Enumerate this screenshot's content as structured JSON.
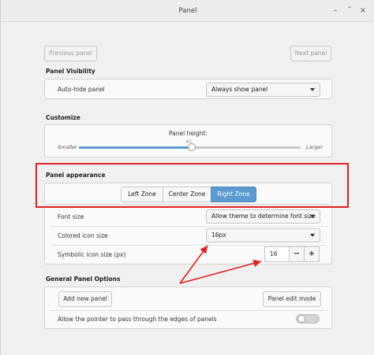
{
  "window": {
    "title": "Panel"
  },
  "nav": {
    "previous_label": "Previous panel",
    "next_label": "Next panel"
  },
  "visibility": {
    "section_title": "Panel Visibility",
    "autohide_label": "Auto-hide panel",
    "autohide_value": "Always show panel"
  },
  "customize": {
    "section_title": "Customize",
    "height_label": "Panel height:",
    "height_value": "40",
    "smaller_label": "Smaller",
    "larger_label": "Larger",
    "height_level_percent": 51
  },
  "appearance": {
    "section_title": "Panel appearance",
    "zones": [
      {
        "label": "Left Zone",
        "active": false
      },
      {
        "label": "Center Zone",
        "active": false
      },
      {
        "label": "Right Zone",
        "active": true
      }
    ],
    "font_size_label": "Font size",
    "font_size_value": "Allow theme to determine font size",
    "colored_icon_label": "Colored icon size",
    "colored_icon_value": "16px",
    "symbolic_icon_label": "Symbolic icon size (px)",
    "symbolic_icon_value": "16",
    "minus_label": "−",
    "plus_label": "+"
  },
  "general": {
    "section_title": "General Panel Options",
    "add_panel_label": "Add new panel",
    "edit_mode_label": "Panel edit mode",
    "pointer_pass_label": "Allow the pointer to pass through the edges of panels",
    "pointer_pass_enabled": false
  },
  "colors": {
    "accent": "#5b9bd1",
    "annotation": "#e02020"
  }
}
